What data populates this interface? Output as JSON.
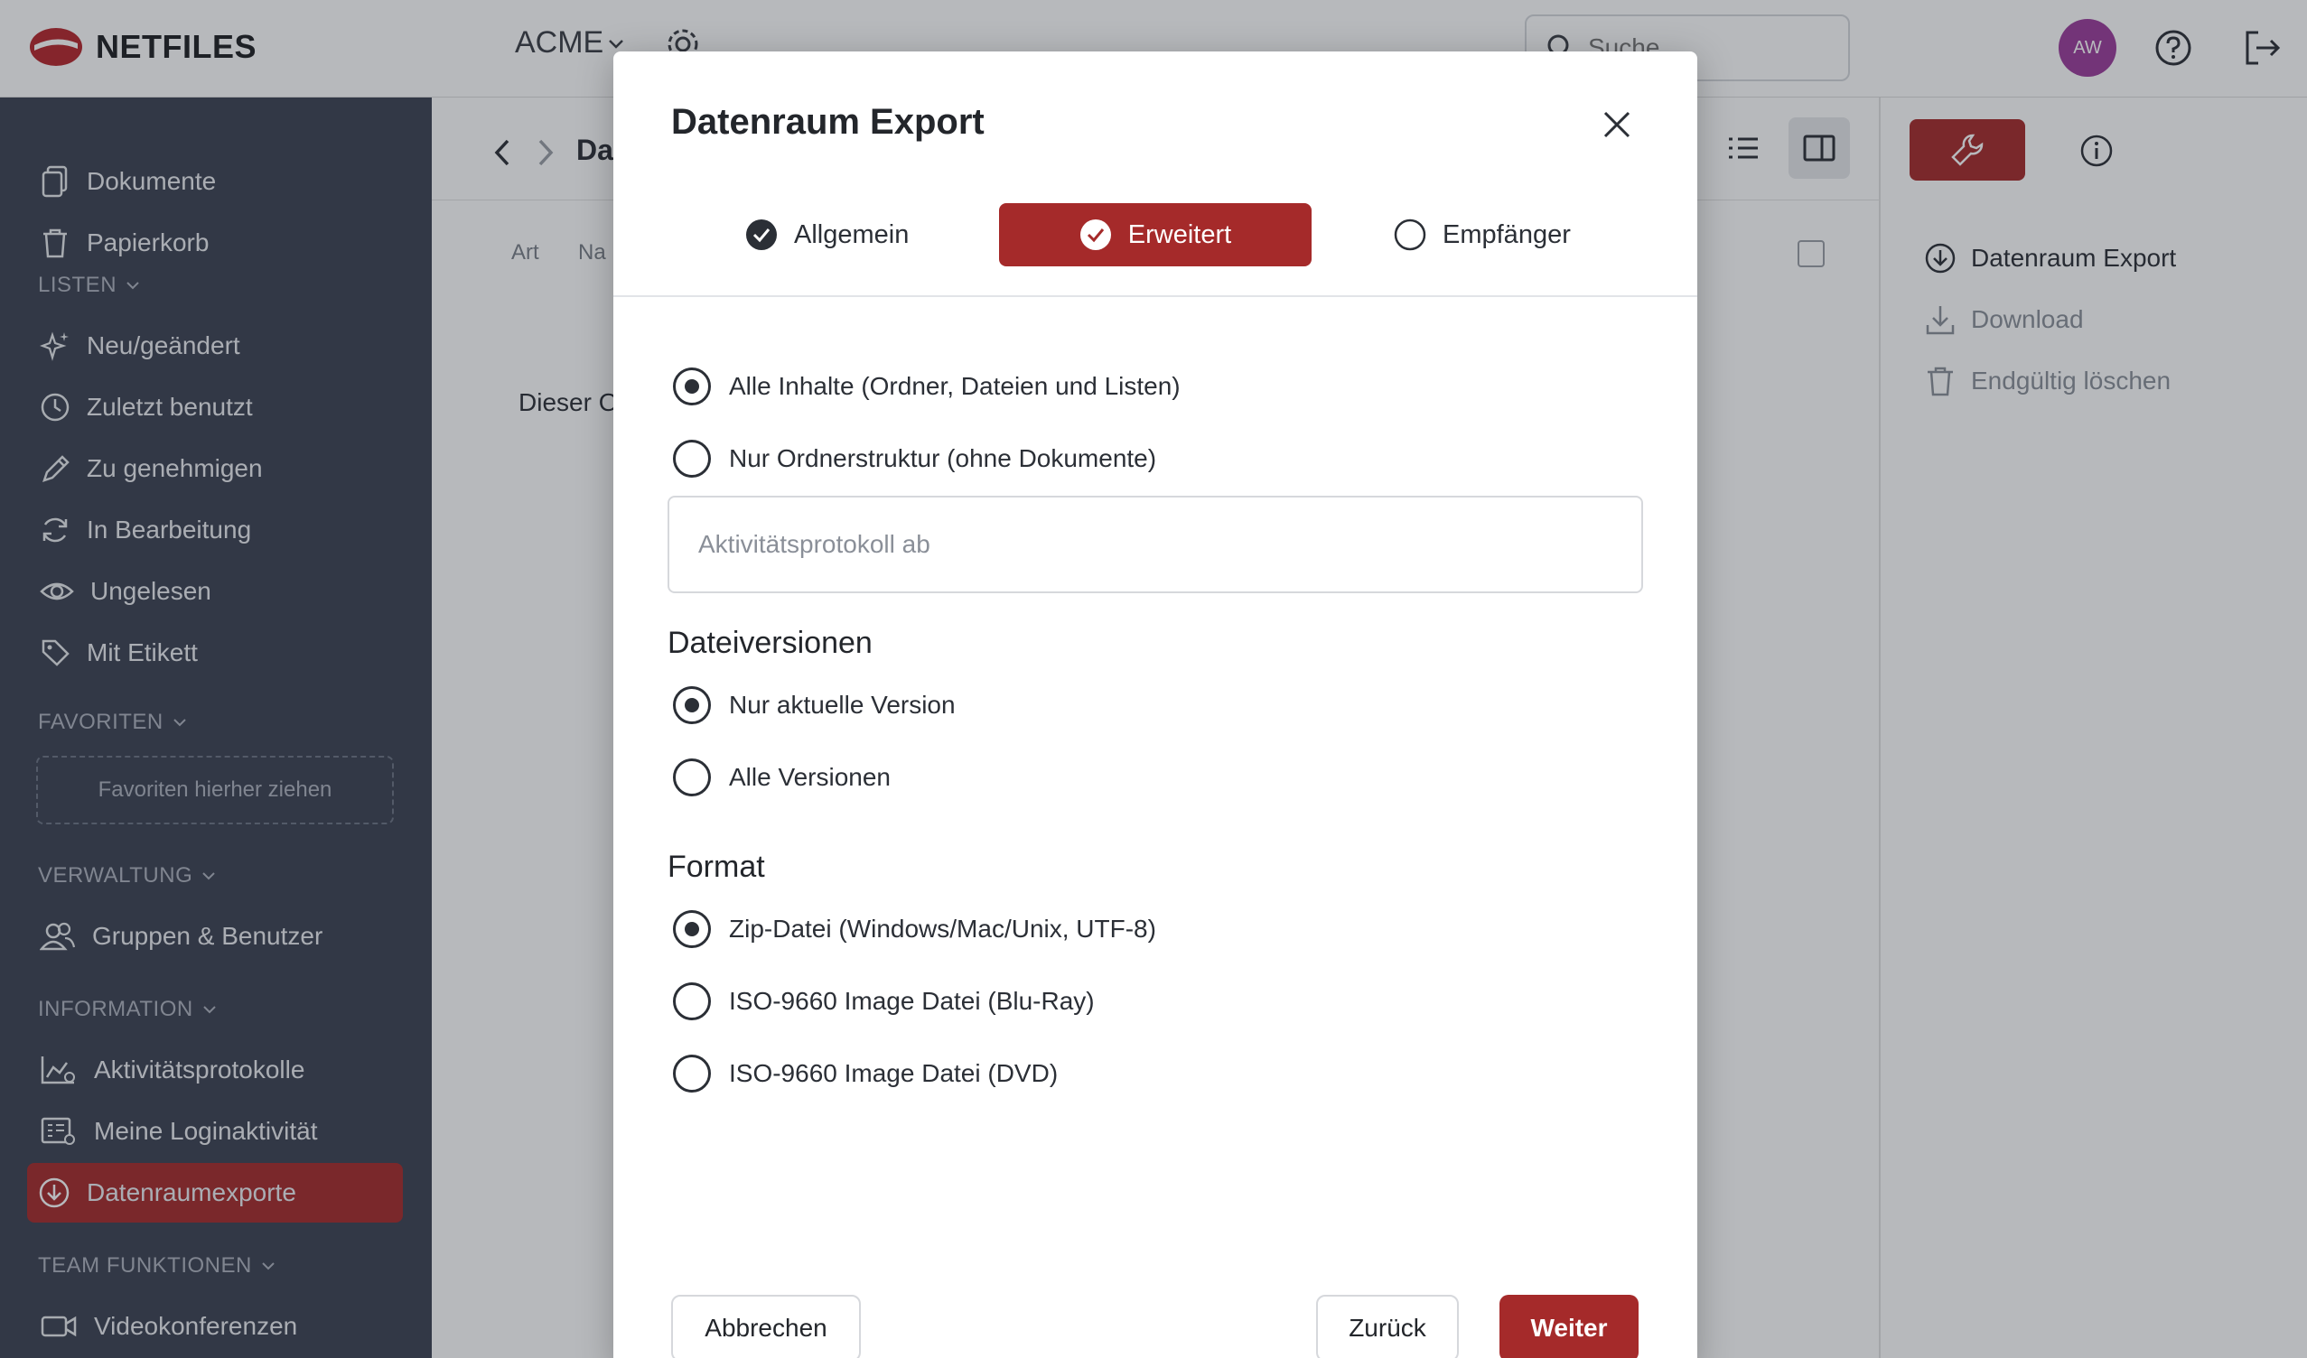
{
  "app": {
    "logo_text": "NETFILES",
    "workspace": "ACME",
    "search_placeholder": "Suche",
    "avatar_initials": "AW",
    "accent": "#a52a2a"
  },
  "sidebar": {
    "top_items": [
      {
        "label": "Dokumente",
        "icon": "document-icon"
      },
      {
        "label": "Papierkorb",
        "icon": "trash-icon"
      }
    ],
    "listen_title": "LISTEN",
    "listen_items": [
      {
        "label": "Neu/geändert",
        "icon": "sparkle-icon"
      },
      {
        "label": "Zuletzt benutzt",
        "icon": "clock-icon"
      },
      {
        "label": "Zu genehmigen",
        "icon": "pencil-icon"
      },
      {
        "label": "In Bearbeitung",
        "icon": "refresh-icon"
      },
      {
        "label": "Ungelesen",
        "icon": "eye-icon"
      },
      {
        "label": "Mit Etikett",
        "icon": "tag-icon"
      }
    ],
    "favoriten_title": "FAVORITEN",
    "favoriten_drop": "Favoriten hierher ziehen",
    "verwaltung_title": "VERWALTUNG",
    "verwaltung_items": [
      {
        "label": "Gruppen & Benutzer",
        "icon": "users-icon"
      }
    ],
    "information_title": "INFORMATION",
    "information_items": [
      {
        "label": "Aktivitätsprotokolle",
        "icon": "activity-chart-icon"
      },
      {
        "label": "Meine Loginaktivität",
        "icon": "login-list-icon"
      },
      {
        "label": "Datenraumexporte",
        "icon": "download-circle-icon",
        "active": true
      }
    ],
    "team_title": "TEAM FUNKTIONEN",
    "team_items": [
      {
        "label": "Videokonferenzen",
        "icon": "video-icon"
      }
    ]
  },
  "main": {
    "breadcrumb": "Da",
    "col_art": "Art",
    "col_name": "Na",
    "empty_text": "Dieser O"
  },
  "right_panel": {
    "items": [
      {
        "label": "Datenraum Export",
        "icon": "download-circle-icon",
        "enabled": true
      },
      {
        "label": "Download",
        "icon": "download-icon",
        "enabled": false
      },
      {
        "label": "Endgültig löschen",
        "icon": "trash-icon",
        "enabled": false
      }
    ]
  },
  "modal": {
    "title": "Datenraum Export",
    "steps": [
      {
        "label": "Allgemein",
        "state": "done"
      },
      {
        "label": "Erweitert",
        "state": "active"
      },
      {
        "label": "Empfänger",
        "state": "pending"
      }
    ],
    "content_options": [
      {
        "label": "Alle Inhalte (Ordner, Dateien und Listen)",
        "selected": true
      },
      {
        "label": "Nur Ordnerstruktur (ohne Dokumente)",
        "selected": false
      }
    ],
    "activity_placeholder": "Aktivitätsprotokoll ab",
    "versions_heading": "Dateiversionen",
    "version_options": [
      {
        "label": "Nur aktuelle Version",
        "selected": true
      },
      {
        "label": "Alle Versionen",
        "selected": false
      }
    ],
    "format_heading": "Format",
    "format_options": [
      {
        "label": "Zip-Datei (Windows/Mac/Unix, UTF-8)",
        "selected": true
      },
      {
        "label": "ISO-9660 Image Datei (Blu-Ray)",
        "selected": false
      },
      {
        "label": "ISO-9660 Image Datei (DVD)",
        "selected": false
      }
    ],
    "cancel_label": "Abbrechen",
    "back_label": "Zurück",
    "next_label": "Weiter"
  }
}
